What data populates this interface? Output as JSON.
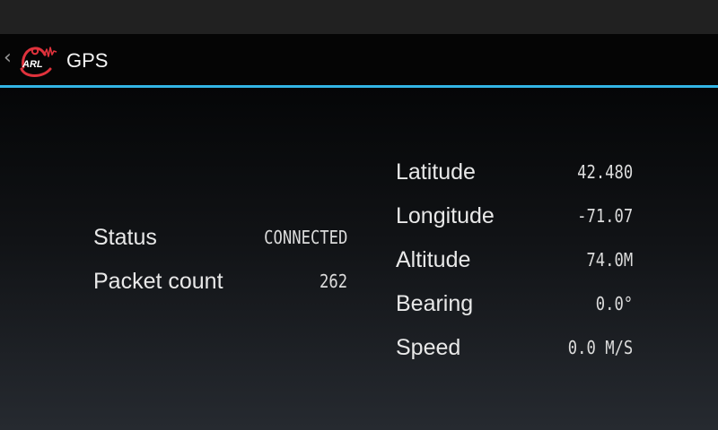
{
  "action_bar": {
    "title": "GPS",
    "logo_text": "ARL"
  },
  "status_panel": [
    {
      "label": "Status",
      "value": "CONNECTED"
    },
    {
      "label": "Packet count",
      "value": "262"
    }
  ],
  "gps_panel": [
    {
      "label": "Latitude",
      "value": "42.480"
    },
    {
      "label": "Longitude",
      "value": "-71.07"
    },
    {
      "label": "Altitude",
      "value": "74.0M"
    },
    {
      "label": "Bearing",
      "value": "0.0°"
    },
    {
      "label": "Speed",
      "value": "0.0 M/S"
    }
  ],
  "colors": {
    "accent": "#33b5e5",
    "logo_red": "#e0323c"
  }
}
